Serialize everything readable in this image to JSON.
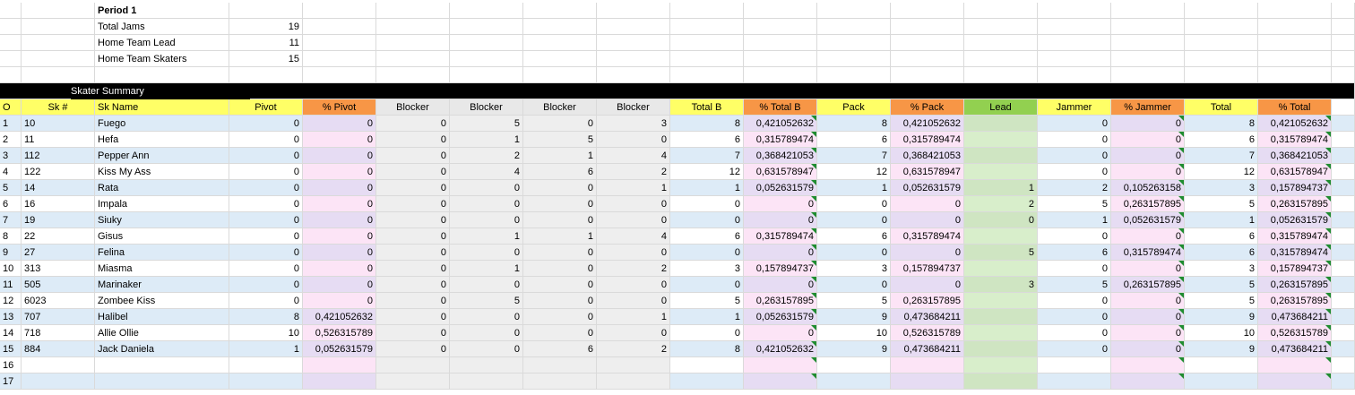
{
  "period": {
    "title": "Period 1",
    "stats": [
      {
        "label": "Total Jams",
        "value": "19"
      },
      {
        "label": "Home Team Lead",
        "value": "11"
      },
      {
        "label": "Home Team Skaters",
        "value": "15"
      }
    ]
  },
  "section_title": "Skater Summary",
  "headers": [
    "O",
    "Sk #",
    "Sk Name",
    "Pivot",
    "% Pivot",
    "Blocker",
    "Blocker",
    "Blocker",
    "Blocker",
    "Total B",
    "% Total B",
    "Pack",
    "% Pack",
    "Lead",
    "Jammer",
    "% Jammer",
    "Total",
    "% Total"
  ],
  "rows": [
    [
      "1",
      "10",
      "Fuego",
      "0",
      "0",
      "0",
      "5",
      "0",
      "3",
      "8",
      "0,421052632",
      "8",
      "0,421052632",
      "",
      "0",
      "0",
      "8",
      "0,421052632"
    ],
    [
      "2",
      "11",
      "Hefa",
      "0",
      "0",
      "0",
      "1",
      "5",
      "0",
      "6",
      "0,315789474",
      "6",
      "0,315789474",
      "",
      "0",
      "0",
      "6",
      "0,315789474"
    ],
    [
      "3",
      "112",
      "Pepper Ann",
      "0",
      "0",
      "0",
      "2",
      "1",
      "4",
      "7",
      "0,368421053",
      "7",
      "0,368421053",
      "",
      "0",
      "0",
      "7",
      "0,368421053"
    ],
    [
      "4",
      "122",
      "Kiss My Ass",
      "0",
      "0",
      "0",
      "4",
      "6",
      "2",
      "12",
      "0,631578947",
      "12",
      "0,631578947",
      "",
      "0",
      "0",
      "12",
      "0,631578947"
    ],
    [
      "5",
      "14",
      "Rata",
      "0",
      "0",
      "0",
      "0",
      "0",
      "1",
      "1",
      "0,052631579",
      "1",
      "0,052631579",
      "1",
      "2",
      "0,105263158",
      "3",
      "0,157894737"
    ],
    [
      "6",
      "16",
      "Impala",
      "0",
      "0",
      "0",
      "0",
      "0",
      "0",
      "0",
      "0",
      "0",
      "0",
      "2",
      "5",
      "0,263157895",
      "5",
      "0,263157895"
    ],
    [
      "7",
      "19",
      "Siuky",
      "0",
      "0",
      "0",
      "0",
      "0",
      "0",
      "0",
      "0",
      "0",
      "0",
      "0",
      "1",
      "0,052631579",
      "1",
      "0,052631579"
    ],
    [
      "8",
      "22",
      "Gisus",
      "0",
      "0",
      "0",
      "1",
      "1",
      "4",
      "6",
      "0,315789474",
      "6",
      "0,315789474",
      "",
      "0",
      "0",
      "6",
      "0,315789474"
    ],
    [
      "9",
      "27",
      "Felina",
      "0",
      "0",
      "0",
      "0",
      "0",
      "0",
      "0",
      "0",
      "0",
      "0",
      "5",
      "6",
      "0,315789474",
      "6",
      "0,315789474"
    ],
    [
      "10",
      "313",
      "Miasma",
      "0",
      "0",
      "0",
      "1",
      "0",
      "2",
      "3",
      "0,157894737",
      "3",
      "0,157894737",
      "",
      "0",
      "0",
      "3",
      "0,157894737"
    ],
    [
      "11",
      "505",
      "Marinaker",
      "0",
      "0",
      "0",
      "0",
      "0",
      "0",
      "0",
      "0",
      "0",
      "0",
      "3",
      "5",
      "0,263157895",
      "5",
      "0,263157895"
    ],
    [
      "12",
      "6023",
      "Zombee Kiss",
      "0",
      "0",
      "0",
      "5",
      "0",
      "0",
      "5",
      "0,263157895",
      "5",
      "0,263157895",
      "",
      "0",
      "0",
      "5",
      "0,263157895"
    ],
    [
      "13",
      "707",
      "Halibel",
      "8",
      "0,421052632",
      "0",
      "0",
      "0",
      "1",
      "1",
      "0,052631579",
      "9",
      "0,473684211",
      "",
      "0",
      "0",
      "9",
      "0,473684211"
    ],
    [
      "14",
      "718",
      "Allie Ollie",
      "10",
      "0,526315789",
      "0",
      "0",
      "0",
      "0",
      "0",
      "0",
      "10",
      "0,526315789",
      "",
      "0",
      "0",
      "10",
      "0,526315789"
    ],
    [
      "15",
      "884",
      "Jack Daniela",
      "1",
      "0,052631579",
      "0",
      "0",
      "6",
      "2",
      "8",
      "0,421052632",
      "9",
      "0,473684211",
      "",
      "0",
      "0",
      "9",
      "0,473684211"
    ],
    [
      "16",
      "",
      "",
      "",
      "",
      "",
      "",
      "",
      "",
      "",
      "",
      "",
      "",
      "",
      "",
      "",
      "",
      ""
    ],
    [
      "17",
      "",
      "",
      "",
      "",
      "",
      "",
      "",
      "",
      "",
      "",
      "",
      "",
      "",
      "",
      "",
      "",
      ""
    ]
  ]
}
